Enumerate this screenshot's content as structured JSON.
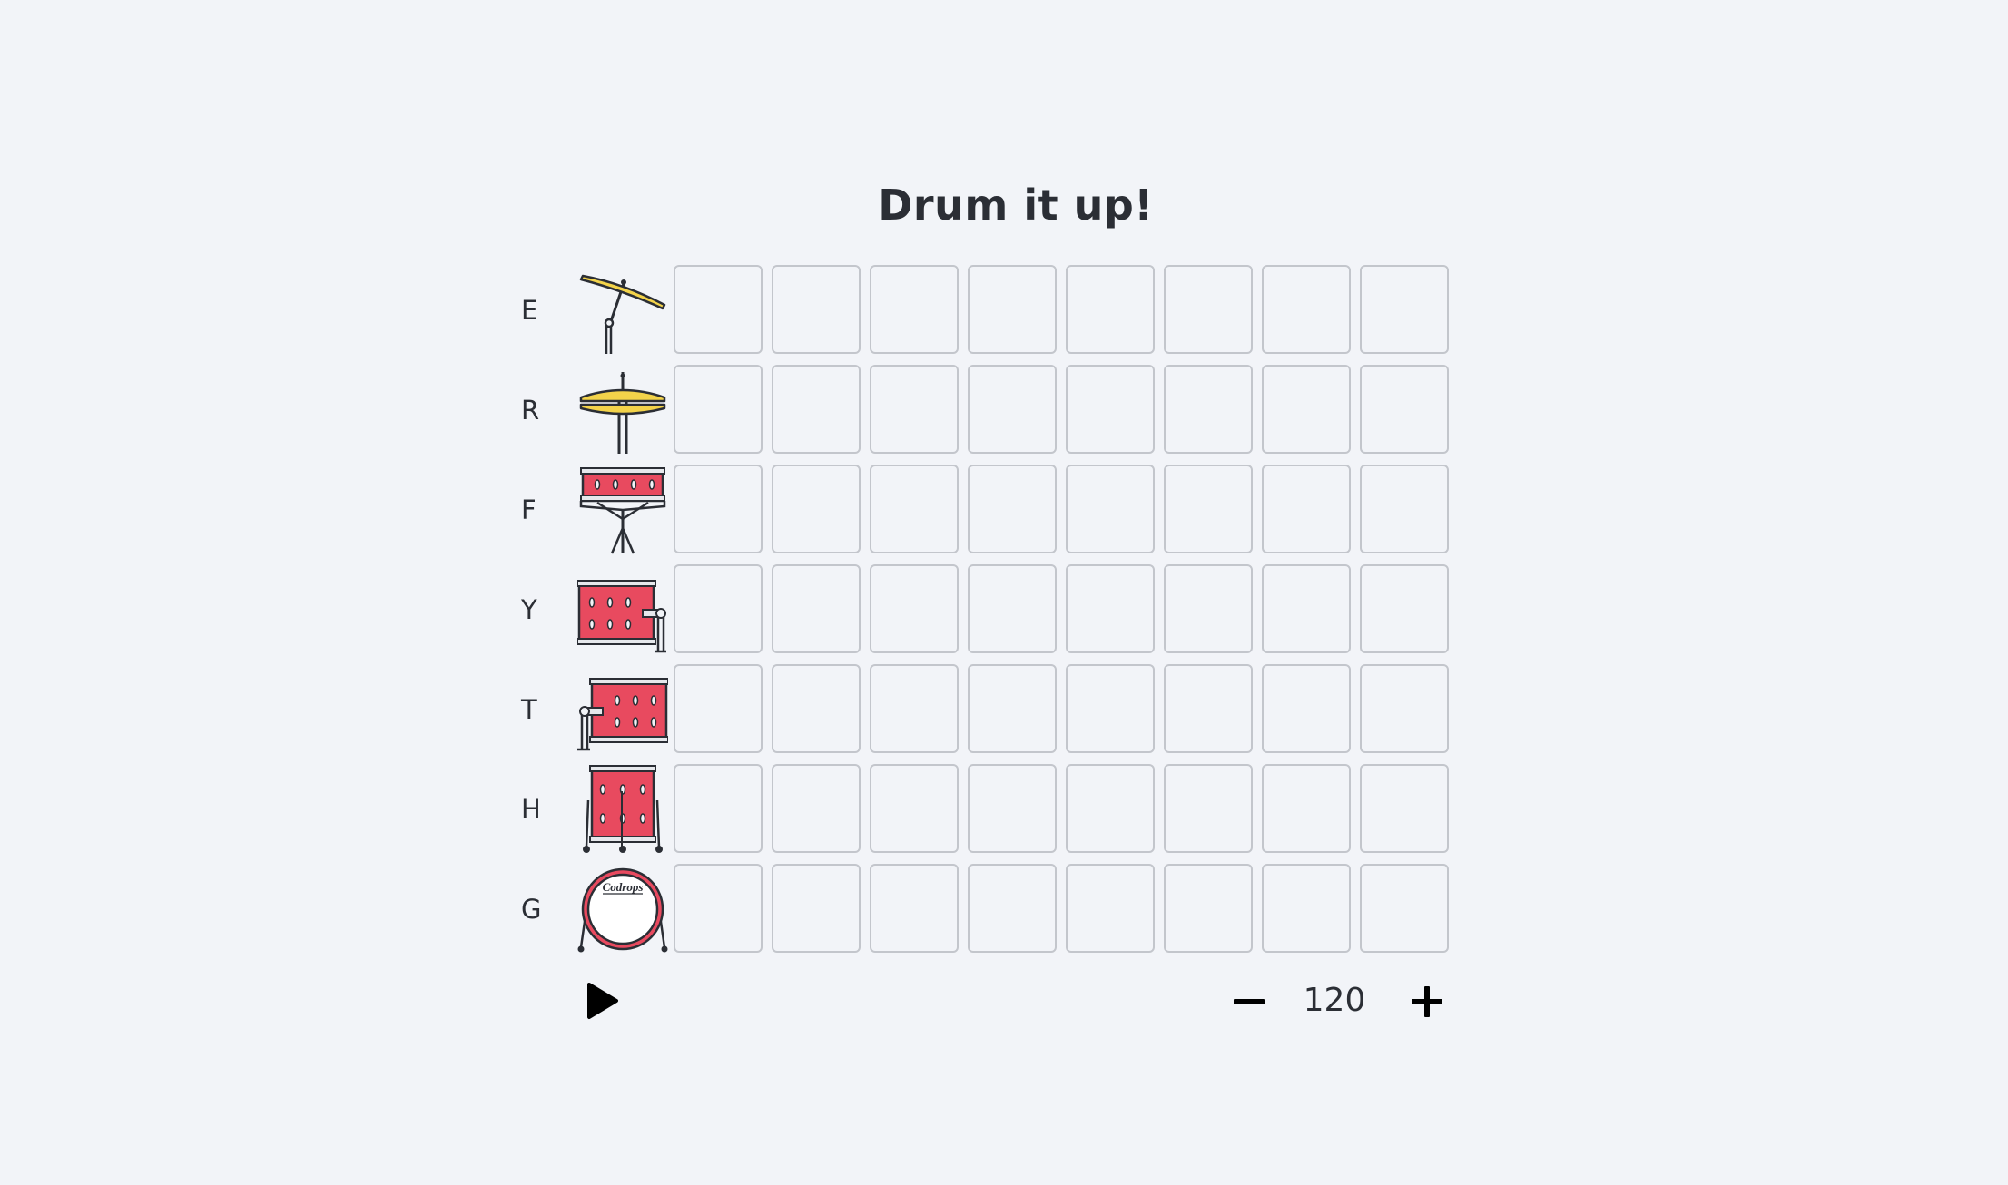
{
  "title": "Drum it up!",
  "rows": [
    {
      "key": "E",
      "icon": "crash-cymbal-icon",
      "steps": [
        false,
        false,
        false,
        false,
        false,
        false,
        false,
        false
      ]
    },
    {
      "key": "R",
      "icon": "hihat-icon",
      "steps": [
        false,
        false,
        false,
        false,
        false,
        false,
        false,
        false
      ]
    },
    {
      "key": "F",
      "icon": "snare-drum-icon",
      "steps": [
        false,
        false,
        false,
        false,
        false,
        false,
        false,
        false
      ]
    },
    {
      "key": "Y",
      "icon": "tom-right-icon",
      "steps": [
        false,
        false,
        false,
        false,
        false,
        false,
        false,
        false
      ]
    },
    {
      "key": "T",
      "icon": "tom-left-icon",
      "steps": [
        false,
        false,
        false,
        false,
        false,
        false,
        false,
        false
      ]
    },
    {
      "key": "H",
      "icon": "floor-tom-icon",
      "steps": [
        false,
        false,
        false,
        false,
        false,
        false,
        false,
        false
      ]
    },
    {
      "key": "G",
      "icon": "bass-drum-icon",
      "logo_text": "Codrops",
      "steps": [
        false,
        false,
        false,
        false,
        false,
        false,
        false,
        false
      ]
    }
  ],
  "controls": {
    "play_icon": "play-icon",
    "minus_icon": "minus-icon",
    "plus_icon": "plus-icon",
    "tempo": "120"
  },
  "colors": {
    "background": "#f2f4f8",
    "drum_red": "#e84a5f",
    "cymbal_yellow": "#f3d34a",
    "outline": "#2b2e35",
    "cell_border": "#c3c6cc"
  }
}
